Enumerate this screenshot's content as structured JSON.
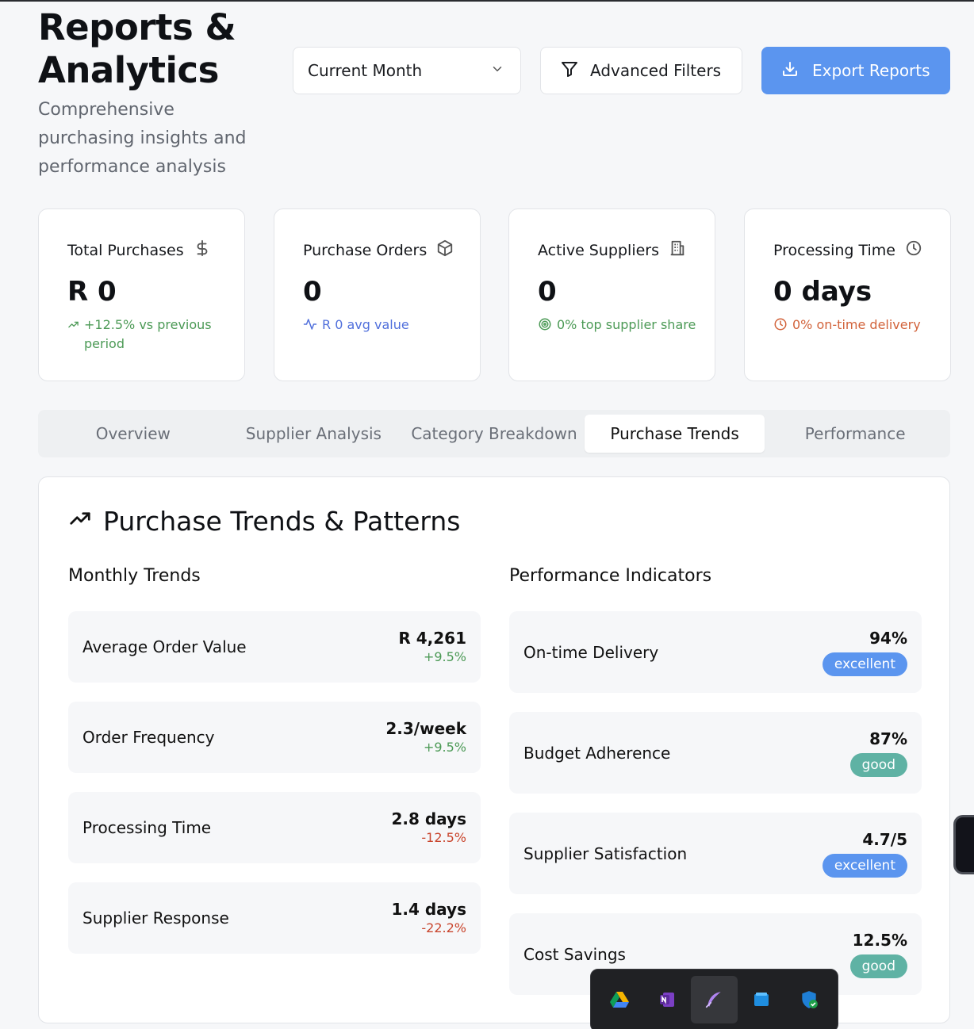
{
  "header": {
    "title": "Reports & Analytics",
    "subtitle": "Comprehensive purchasing insights and performance analysis"
  },
  "controls": {
    "period_select": "Current Month",
    "filters_label": "Advanced Filters",
    "export_label": "Export Reports"
  },
  "kpis": [
    {
      "label": "Total Purchases",
      "value": "R 0",
      "sub": "+12.5% vs previous period",
      "icon": "dollar-icon"
    },
    {
      "label": "Purchase Orders",
      "value": "0",
      "sub": "R 0 avg value",
      "icon": "package-icon"
    },
    {
      "label": "Active Suppliers",
      "value": "0",
      "sub": "0% top supplier share",
      "icon": "building-icon"
    },
    {
      "label": "Processing Time",
      "value": "0 days",
      "sub": "0% on-time delivery",
      "icon": "clock-icon"
    }
  ],
  "tabs": [
    {
      "label": "Overview"
    },
    {
      "label": "Supplier Analysis"
    },
    {
      "label": "Category Breakdown"
    },
    {
      "label": "Purchase Trends",
      "active": true
    },
    {
      "label": "Performance"
    }
  ],
  "panel": {
    "title": "Purchase Trends & Patterns",
    "monthly_title": "Monthly Trends",
    "indicators_title": "Performance Indicators"
  },
  "monthly_trends": [
    {
      "name": "Average Order Value",
      "value": "R 4,261",
      "change": "+9.5%"
    },
    {
      "name": "Order Frequency",
      "value": "2.3/week",
      "change": "+9.5%"
    },
    {
      "name": "Processing Time",
      "value": "2.8 days",
      "change": "-12.5%"
    },
    {
      "name": "Supplier Response",
      "value": "1.4 days",
      "change": "-22.2%"
    }
  ],
  "indicators": [
    {
      "name": "On-time Delivery",
      "value": "94%",
      "status": "excellent"
    },
    {
      "name": "Budget Adherence",
      "value": "87%",
      "status": "good"
    },
    {
      "name": "Supplier Satisfaction",
      "value": "4.7/5",
      "status": "excellent"
    },
    {
      "name": "Cost Savings",
      "value": "12.5%",
      "status": "good"
    }
  ],
  "colors": {
    "primary": "#5b95ef",
    "good": "#5fb2a4",
    "positive": "#4c9a56",
    "negative": "#c9452d",
    "link": "#5170dc",
    "warning": "#d2633b"
  },
  "taskbar": {
    "apps": [
      "google-drive-icon",
      "onenote-icon",
      "feather-pen-icon",
      "windows-store-icon",
      "windows-security-icon"
    ]
  }
}
